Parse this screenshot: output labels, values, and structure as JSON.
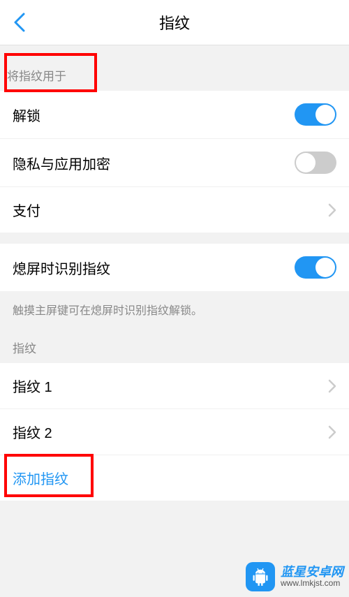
{
  "header": {
    "title": "指纹"
  },
  "section_use": {
    "header": "将指纹用于",
    "items": [
      {
        "label": "解锁",
        "control": "switch",
        "state": "on"
      },
      {
        "label": "隐私与应用加密",
        "control": "switch",
        "state": "off"
      },
      {
        "label": "支付",
        "control": "disclosure"
      }
    ]
  },
  "section_screen_off": {
    "items": [
      {
        "label": "熄屏时识别指纹",
        "control": "switch",
        "state": "on"
      }
    ],
    "description": "触摸主屏键可在熄屏时识别指纹解锁。"
  },
  "section_fingerprints": {
    "header": "指纹",
    "items": [
      {
        "label": "指纹 1",
        "control": "disclosure"
      },
      {
        "label": "指纹 2",
        "control": "disclosure"
      }
    ],
    "add_label": "添加指纹"
  },
  "watermark": {
    "brand_top": "蓝星安卓网",
    "brand_bottom": "www.lmkjst.com"
  }
}
